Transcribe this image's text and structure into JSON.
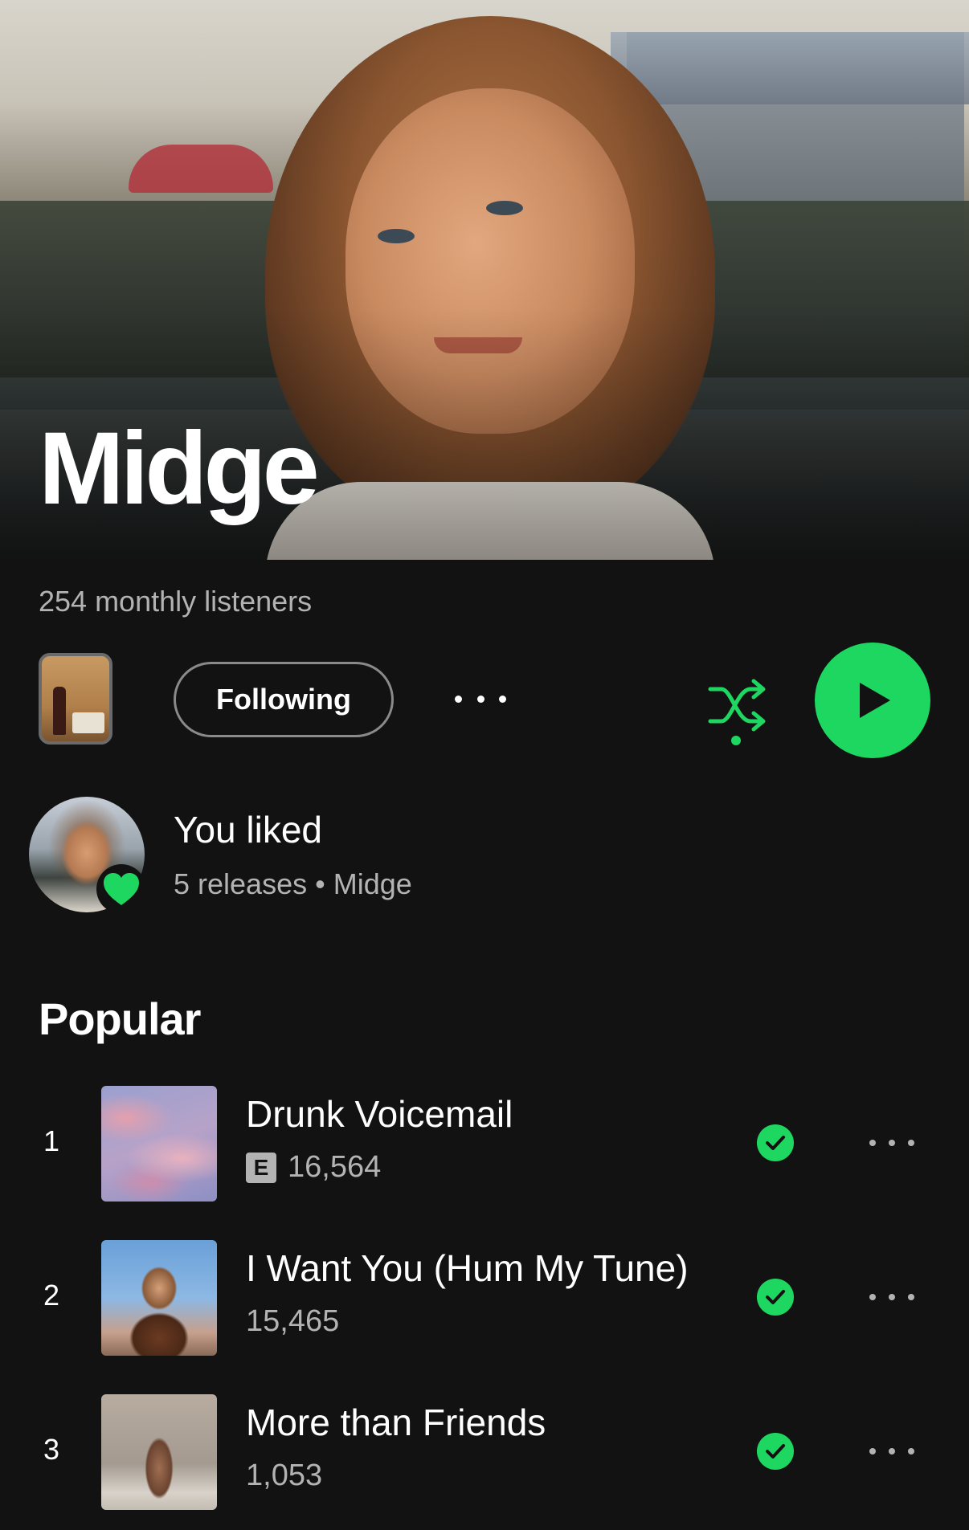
{
  "artist": {
    "name": "Midge",
    "monthly_listeners": "254 monthly listeners"
  },
  "controls": {
    "follow_label": "Following",
    "more_icon": "more-horizontal-icon",
    "shuffle_icon": "shuffle-icon",
    "play_icon": "play-icon"
  },
  "liked": {
    "title": "You liked",
    "subtitle": "5 releases • Midge",
    "badge_icon": "heart-icon"
  },
  "popular": {
    "title": "Popular",
    "tracks": [
      {
        "number": "1",
        "title": "Drunk Voicemail",
        "explicit": true,
        "explicit_label": "E",
        "plays": "16,564",
        "saved": true
      },
      {
        "number": "2",
        "title": "I Want You (Hum My Tune)",
        "explicit": false,
        "plays": "15,465",
        "saved": true
      },
      {
        "number": "3",
        "title": "More than Friends",
        "explicit": false,
        "plays": "1,053",
        "saved": true
      }
    ]
  },
  "colors": {
    "accent": "#1ed760",
    "background": "#121212",
    "secondary_text": "#b3b3b3"
  }
}
